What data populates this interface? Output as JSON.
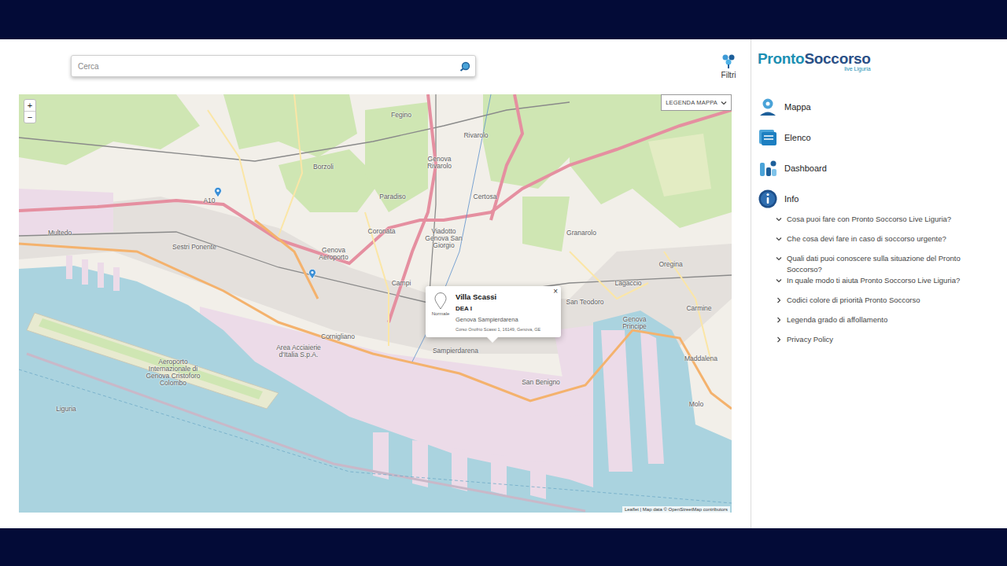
{
  "search": {
    "placeholder": "Cerca"
  },
  "filters": {
    "label": "Filtri"
  },
  "map": {
    "zoom_in": "+",
    "zoom_out": "−",
    "legend_button": "LEGENDA MAPPA",
    "attribution": "Leaflet | Map data © OpenStreetMap contributors",
    "labels": [
      "Multedo",
      "Sestri Ponente",
      "Borzoli",
      "Fegino",
      "Rivarolo",
      "Genova Rivarolo",
      "Paradiso",
      "Certosa",
      "Coronata",
      "Viadotto Genova San Giorgio",
      "Genova Aeroporto",
      "Campi",
      "Cornigliano",
      "Sampierdarena",
      "San Benigno",
      "Granarolo",
      "Oregina",
      "Lagaccio",
      "San Teodoro",
      "Carmine",
      "Maddalena",
      "Molo",
      "Area Acciaierie d'Italia S.p.A.",
      "Aeroporto Internazionale di Genova Cristoforo Colombo",
      "Liguria",
      "A10",
      "Genova Principe"
    ]
  },
  "popup": {
    "title": "Villa Scassi",
    "type": "DEA I",
    "area": "Genova Sampierdarena",
    "address": "Corso Onofrio Scassi 1, 16149, Genova, GE",
    "status": "Normale",
    "close": "×"
  },
  "sidebar": {
    "logo": {
      "word1": "Pronto",
      "word2": "Soccorso",
      "tagline": "live Liguria"
    },
    "items": [
      {
        "label": "Mappa"
      },
      {
        "label": "Elenco"
      },
      {
        "label": "Dashboard"
      },
      {
        "label": "Info"
      }
    ],
    "info_items": [
      {
        "label": "Cosa puoi fare con Pronto Soccorso Live Liguria?",
        "expanded": true
      },
      {
        "label": "Che cosa devi fare in caso di soccorso urgente?",
        "expanded": true
      },
      {
        "label": "Quali dati puoi conoscere sulla situazione del Pronto Soccorso?",
        "expanded": true
      },
      {
        "label": "In quale modo ti aiuta Pronto Soccorso Live Liguria?",
        "expanded": true
      },
      {
        "label": "Codici colore di priorità Pronto Soccorso",
        "expanded": false
      },
      {
        "label": "Legenda grado di affollamento",
        "expanded": false
      },
      {
        "label": "Privacy Policy",
        "expanded": false
      }
    ]
  }
}
